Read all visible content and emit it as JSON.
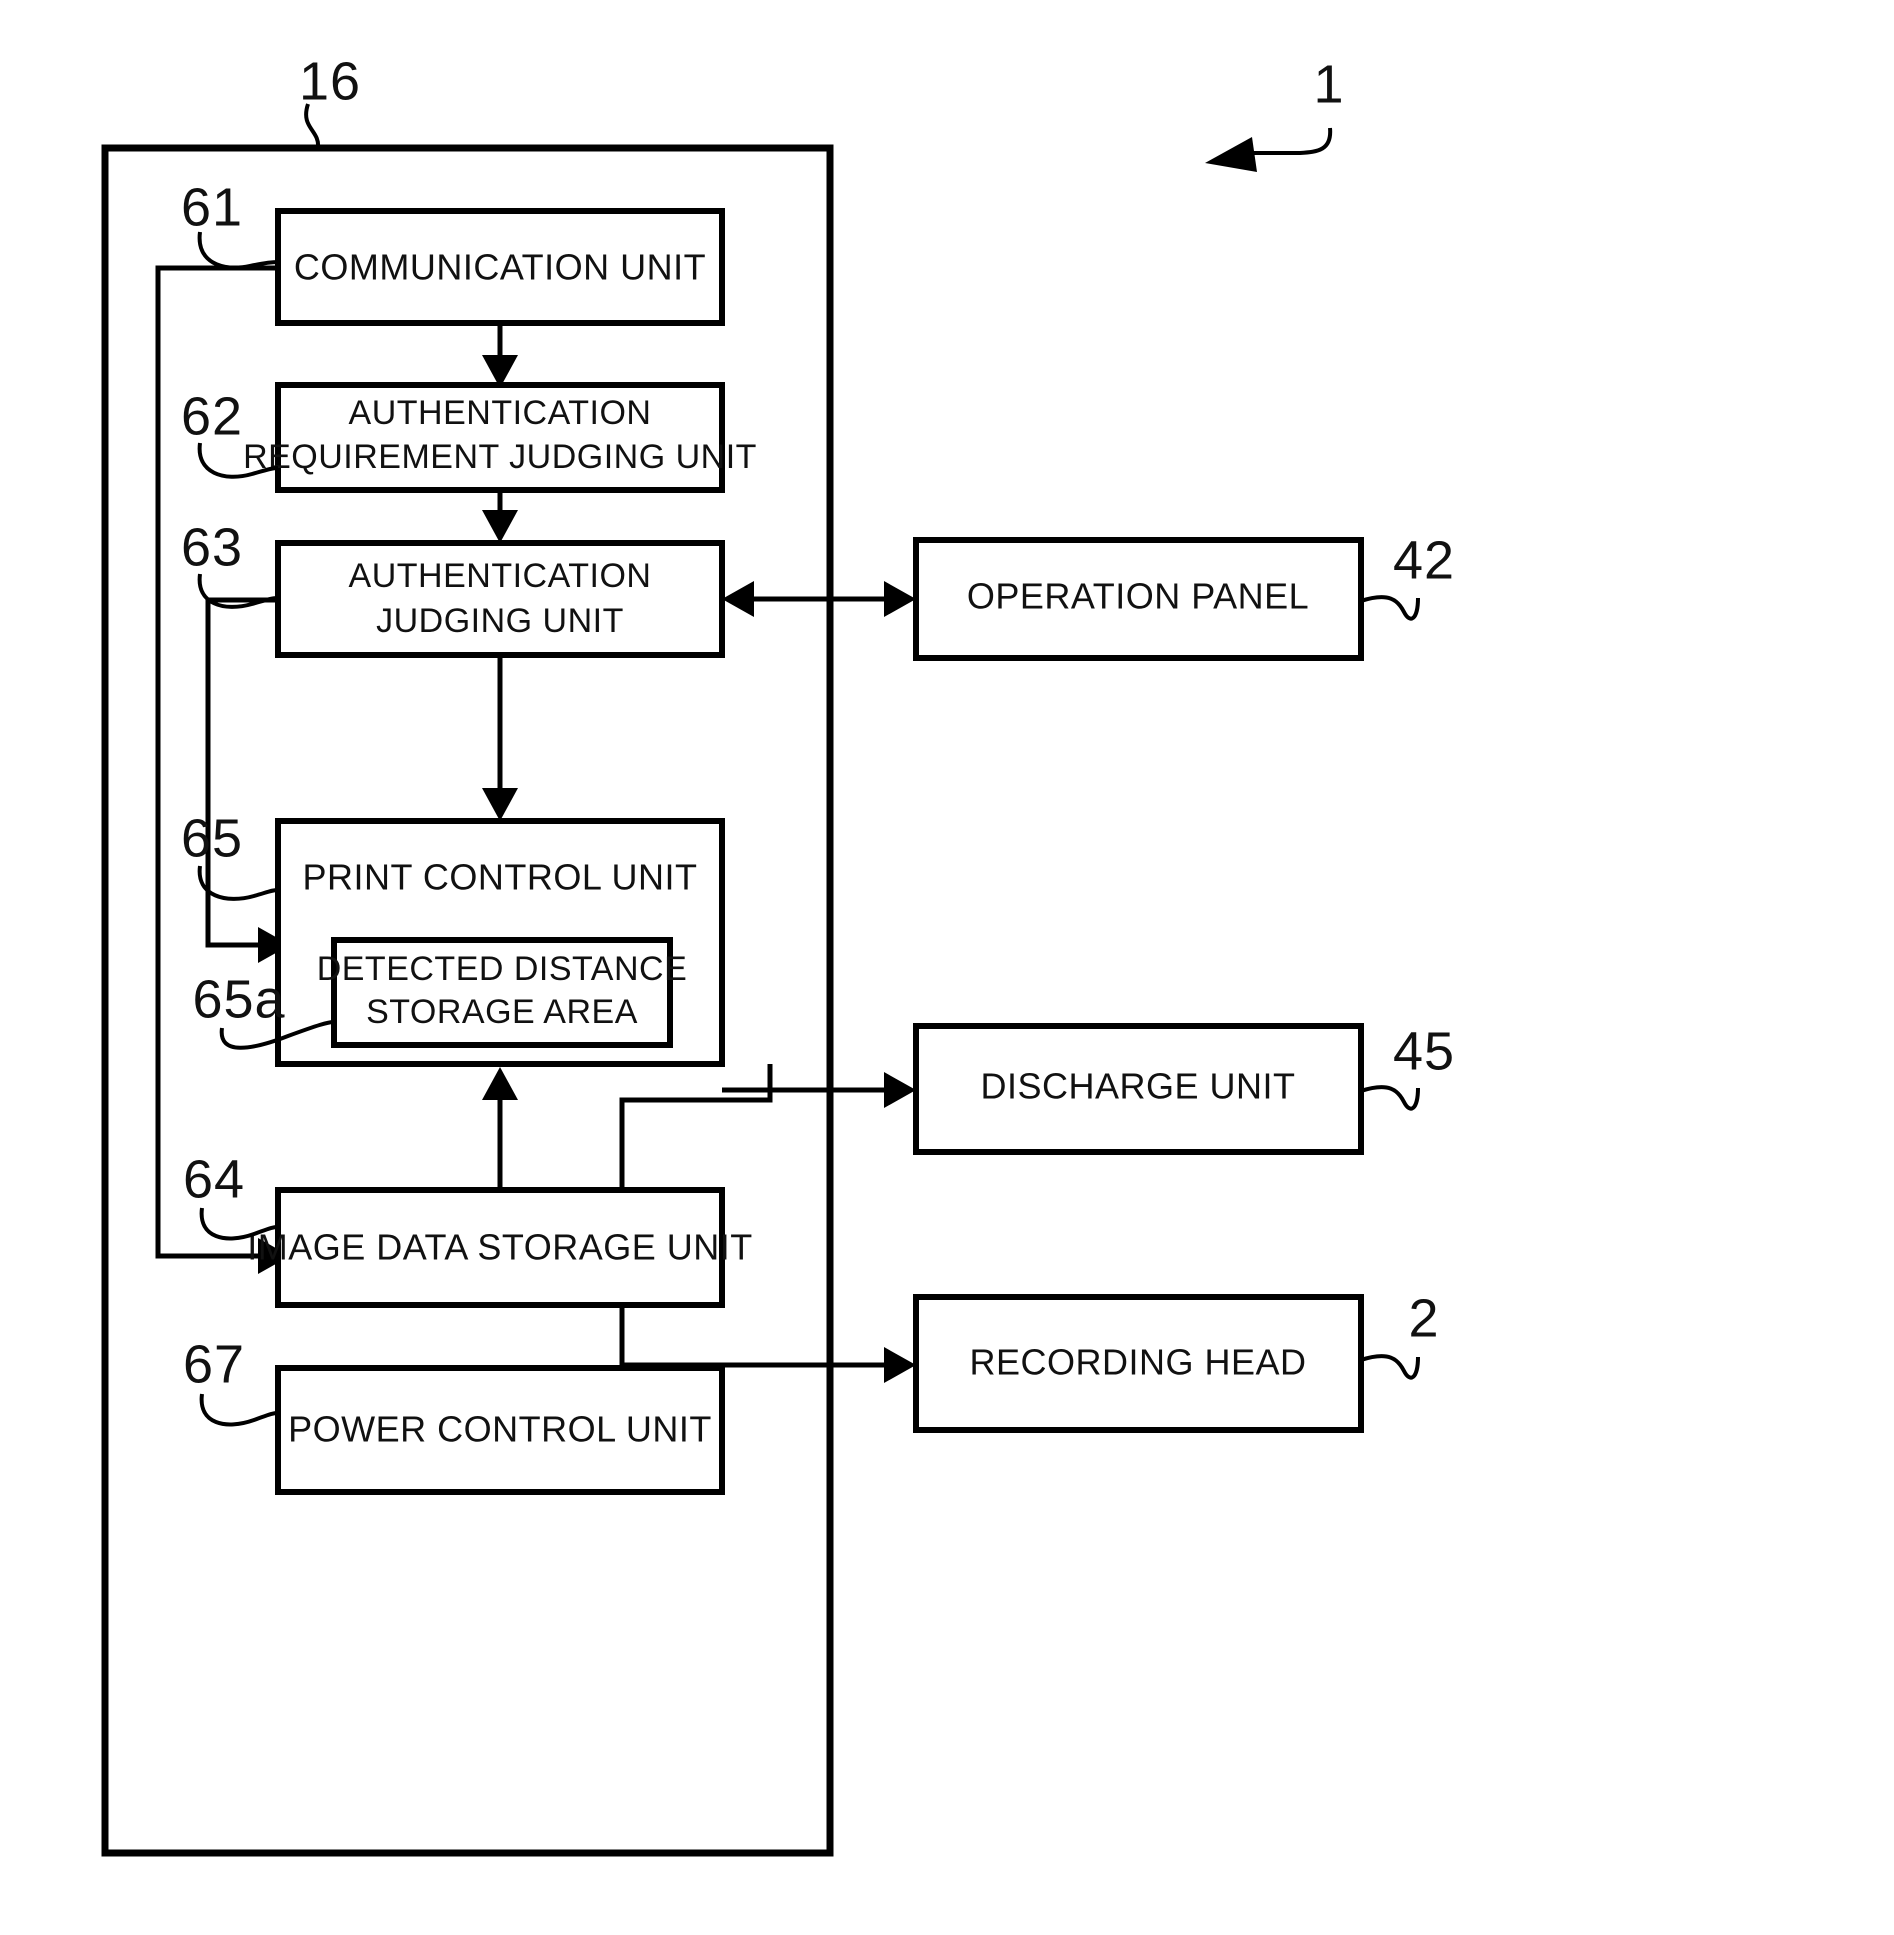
{
  "figure": {
    "type": "patent-block-diagram",
    "system_reference": "1",
    "frame_reference": "16",
    "blocks": [
      {
        "id": "communication-unit",
        "ref": "61",
        "label": "COMMUNICATION UNIT",
        "lines": [
          "COMMUNICATION UNIT"
        ]
      },
      {
        "id": "authentication-requirement-judging-unit",
        "ref": "62",
        "label": "AUTHENTICATION REQUIREMENT JUDGING UNIT",
        "lines": [
          "AUTHENTICATION",
          "REQUIREMENT JUDGING UNIT"
        ]
      },
      {
        "id": "authentication-judging-unit",
        "ref": "63",
        "label": "AUTHENTICATION JUDGING UNIT",
        "lines": [
          "AUTHENTICATION",
          "JUDGING UNIT"
        ]
      },
      {
        "id": "print-control-unit",
        "ref": "65",
        "label": "PRINT CONTROL UNIT",
        "lines": [
          "PRINT CONTROL UNIT"
        ]
      },
      {
        "id": "detected-distance-storage-area",
        "ref": "65a",
        "label": "DETECTED DISTANCE STORAGE AREA",
        "lines": [
          "DETECTED DISTANCE",
          "STORAGE AREA"
        ]
      },
      {
        "id": "image-data-storage-unit",
        "ref": "64",
        "label": "IMAGE DATA STORAGE UNIT",
        "lines": [
          "IMAGE DATA STORAGE UNIT"
        ]
      },
      {
        "id": "power-control-unit",
        "ref": "67",
        "label": "POWER CONTROL UNIT",
        "lines": [
          "POWER CONTROL UNIT"
        ]
      },
      {
        "id": "operation-panel",
        "ref": "42",
        "label": "OPERATION PANEL",
        "lines": [
          "OPERATION PANEL"
        ]
      },
      {
        "id": "discharge-unit",
        "ref": "45",
        "label": "DISCHARGE UNIT",
        "lines": [
          "DISCHARGE UNIT"
        ]
      },
      {
        "id": "recording-head",
        "ref": "2",
        "label": "RECORDING HEAD",
        "lines": [
          "RECORDING HEAD"
        ]
      }
    ],
    "connections": [
      {
        "from": "communication-unit",
        "to": "authentication-requirement-judging-unit",
        "style": "arrow-down"
      },
      {
        "from": "authentication-requirement-judging-unit",
        "to": "authentication-judging-unit",
        "style": "arrow-down"
      },
      {
        "from": "authentication-judging-unit",
        "to": "print-control-unit",
        "style": "arrow-down"
      },
      {
        "from": "authentication-judging-unit",
        "to": "operation-panel",
        "style": "bidirectional"
      },
      {
        "from": "communication-unit",
        "to": "image-data-storage-unit",
        "style": "arrow-left-routed"
      },
      {
        "from": "authentication-judging-unit",
        "to": "print-control-unit",
        "style": "arrow-left-routed"
      },
      {
        "from": "image-data-storage-unit",
        "to": "print-control-unit",
        "style": "arrow-up"
      },
      {
        "from": "print-control-unit",
        "to": "discharge-unit",
        "style": "arrow-right"
      },
      {
        "from": "print-control-unit",
        "to": "recording-head",
        "style": "arrow-right-routed"
      }
    ],
    "colors": {
      "stroke": "#000000",
      "fill": "#ffffff",
      "text": "#111111"
    }
  }
}
